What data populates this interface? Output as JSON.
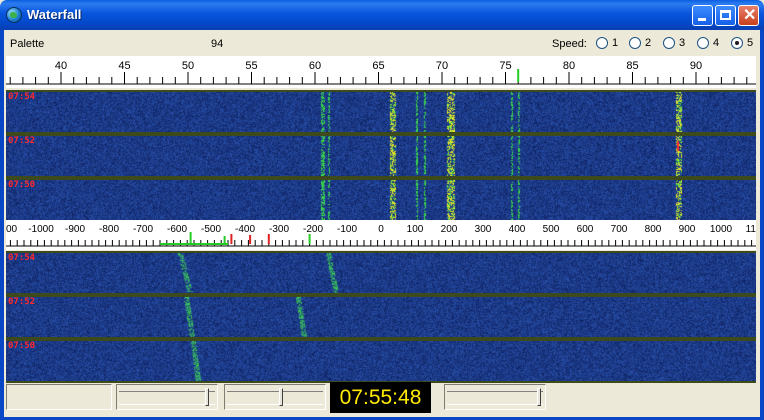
{
  "window": {
    "title": "Waterfall",
    "minimize_label": "_",
    "maximize_label": "□",
    "close_label": "✕"
  },
  "toolbar": {
    "palette_label": "Palette",
    "palette_value": "94",
    "speed_label": "Speed:",
    "speed_options": [
      "1",
      "2",
      "3",
      "4",
      "5"
    ],
    "speed_selected": "5"
  },
  "top_ruler": {
    "ticks": [
      "40",
      "45",
      "50",
      "55",
      "60",
      "65",
      "70",
      "75",
      "80",
      "85",
      "90"
    ],
    "marker_value": 76
  },
  "top_waterfall": {
    "timestamps": [
      "07:54",
      "07:52",
      "07:50"
    ]
  },
  "bottom_ruler": {
    "ticks": [
      "00",
      "-1000",
      "-900",
      "-800",
      "-700",
      "-600",
      "-500",
      "-400",
      "-300",
      "-200",
      "-100",
      "0",
      "100",
      "200",
      "300",
      "400",
      "500",
      "600",
      "700",
      "800",
      "900",
      "1000",
      "11"
    ]
  },
  "bottom_waterfall": {
    "timestamps": [
      "07:54",
      "07:52",
      "07:50"
    ]
  },
  "status_bar": {
    "clock": "07:55:48"
  },
  "colors": {
    "waterfall_background": "#142a6e",
    "signal_green": "#39d24a",
    "signal_yellow": "#e5e52a",
    "signal_red": "#ff3030",
    "timestamp_red": "#ff2a2a",
    "clock_text": "#ffea00",
    "titlebar_blue": "#0855dd"
  }
}
